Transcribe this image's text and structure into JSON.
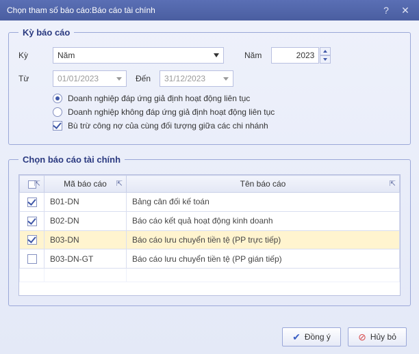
{
  "window": {
    "title": "Chọn tham số báo cáo:Báo cáo tài chính"
  },
  "period_group": {
    "legend": "Kỳ báo cáo",
    "ky_label": "Kỳ",
    "ky_value": "Năm",
    "nam_label": "Năm",
    "nam_value": "2023",
    "tu_label": "Từ",
    "tu_value": "01/01/2023",
    "den_label": "Đến",
    "den_value": "31/12/2023",
    "radio1": "Doanh nghiệp đáp ứng giả định hoạt động liên tục",
    "radio2": "Doanh nghiệp không đáp ứng giả định hoạt động liên tục",
    "radio_selected": 1,
    "checkbox1": "Bù trừ công nợ của cùng đối tượng giữa các chi nhánh",
    "checkbox1_checked": true
  },
  "reports_group": {
    "legend": "Chọn báo cáo tài chính",
    "columns": {
      "code": "Mã báo cáo",
      "name": "Tên báo cáo"
    },
    "rows": [
      {
        "checked": true,
        "code": "B01-DN",
        "name": "Bảng cân đối kế toán"
      },
      {
        "checked": true,
        "code": "B02-DN",
        "name": "Báo cáo kết quả hoạt động kinh doanh"
      },
      {
        "checked": true,
        "code": "B03-DN",
        "name": "Báo cáo lưu chuyển tiền tệ (PP trực tiếp)"
      },
      {
        "checked": false,
        "code": "B03-DN-GT",
        "name": "Báo cáo lưu chuyển tiền tệ (PP gián tiếp)"
      }
    ],
    "selected_row_index": 2
  },
  "footer": {
    "ok": "Đồng ý",
    "cancel": "Hủy bỏ"
  }
}
